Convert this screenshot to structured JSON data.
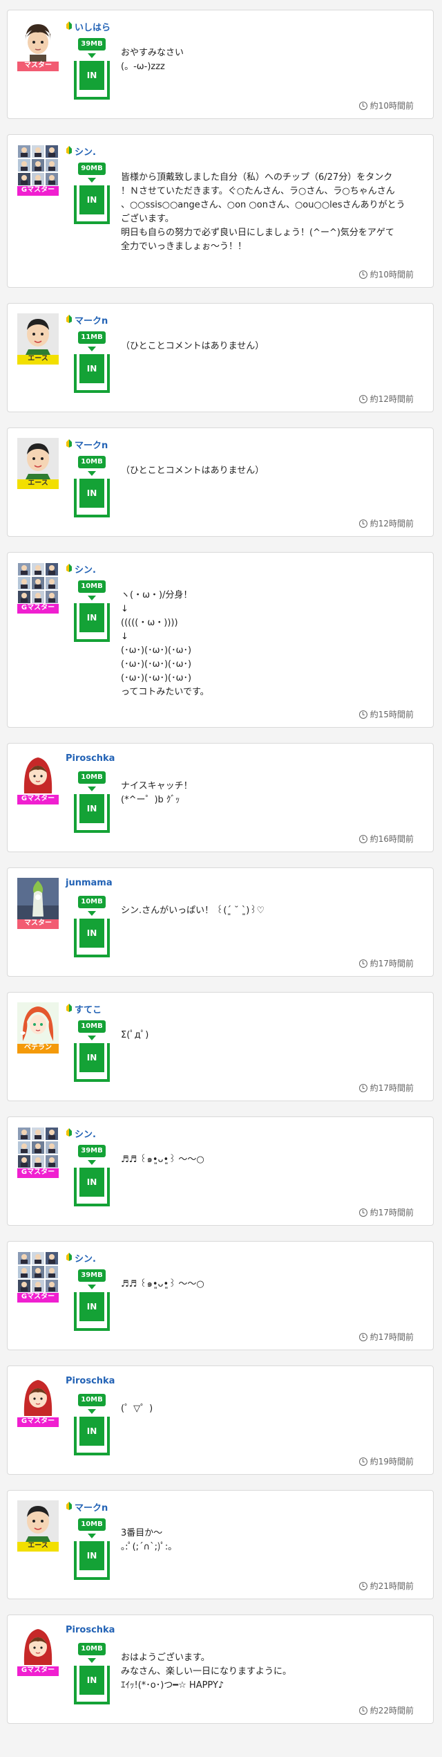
{
  "feed": [
    {
      "avatar": "boy-face",
      "name": "いしはら",
      "beginner": true,
      "rank": "マスター",
      "rank_type": "master",
      "mb": "39MB",
      "in_label": "IN",
      "comment": "おやすみなさい\n(。-ω-)zzz",
      "time": "約10時間前",
      "height": 158
    },
    {
      "avatar": "collage",
      "name": "シン.",
      "beginner": true,
      "rank": "Gマスター",
      "rank_type": "gmaster",
      "mb": "90MB",
      "in_label": "IN",
      "comment": "皆様から頂戴致しました自分（私）へのチップ（6/27分）をタンク\n！Ｎさせていただきます。ぐ○たんさん、ラ○さん、ラ○ちゃんさん\n、○○ssis○○angeさん、○on ○onさん、○ou○○lesさんありがとう\nございます。\n明日も自らの努力で必ず良い日にしましょう！(^ー^)気分をアゲて\n全力でいっきましょぉ～う！！",
      "time": "約10時間前",
      "height": 222
    },
    {
      "avatar": "man-face",
      "name": "マークn",
      "beginner": true,
      "rank": "エース",
      "rank_type": "ace",
      "mb": "11MB",
      "in_label": "IN",
      "comment": "（ひとことコメントはありません）",
      "time": "約12時間前",
      "height": 158
    },
    {
      "avatar": "man-face",
      "name": "マークn",
      "beginner": true,
      "rank": "エース",
      "rank_type": "ace",
      "mb": "10MB",
      "in_label": "IN",
      "comment": "（ひとことコメントはありません）",
      "time": "約12時間前",
      "height": 158
    },
    {
      "avatar": "collage",
      "name": "シン.",
      "beginner": true,
      "rank": "Gマスター",
      "rank_type": "gmaster",
      "mb": "10MB",
      "in_label": "IN",
      "comment": "ヽ(・ω・)/分身！\n↓\n(((((・ω・))))\n↓\n(･ω･)(･ω･)(･ω･)\n(･ω･)(･ω･)(･ω･)\n(･ω･)(･ω･)(･ω･)\nってコトみたいです。",
      "time": "約15時間前",
      "height": 254
    },
    {
      "avatar": "red-hood",
      "name": "Piroschka",
      "beginner": false,
      "rank": "Gマスター",
      "rank_type": "gmaster",
      "mb": "10MB",
      "in_label": "IN",
      "comment": "ナイスキャッチ！\n(*^ー゜)b ｸﾞｯ",
      "time": "約16時間前",
      "height": 158
    },
    {
      "avatar": "statue",
      "name": "junmama",
      "beginner": false,
      "rank": "マスター",
      "rank_type": "master",
      "mb": "10MB",
      "in_label": "IN",
      "comment": "シン.さんがいっぱい！ ꒰(ˊ͈ ˘ ˋ͈)꒱♡",
      "time": "約17時間前",
      "height": 158
    },
    {
      "avatar": "anime-girl",
      "name": "すてこ",
      "beginner": true,
      "rank": "ベテラン",
      "rank_type": "veteran",
      "mb": "10MB",
      "in_label": "IN",
      "comment": "Σ(ﾟдﾟ)",
      "time": "約17時間前",
      "height": 158
    },
    {
      "avatar": "collage",
      "name": "シン.",
      "beginner": true,
      "rank": "Gマスター",
      "rank_type": "gmaster",
      "mb": "39MB",
      "in_label": "IN",
      "comment": "♬♬ ꒰๑•͈ᴗ•͈꒱ 〜〜○",
      "time": "約17時間前",
      "height": 158
    },
    {
      "avatar": "collage",
      "name": "シン.",
      "beginner": true,
      "rank": "Gマスター",
      "rank_type": "gmaster",
      "mb": "39MB",
      "in_label": "IN",
      "comment": "♬♬ ꒰๑•͈ᴗ•͈꒱ 〜〜○",
      "time": "約17時間前",
      "height": 158
    },
    {
      "avatar": "red-hood",
      "name": "Piroschka",
      "beginner": false,
      "rank": "Gマスター",
      "rank_type": "gmaster",
      "mb": "10MB",
      "in_label": "IN",
      "comment": "(゜▽゜)",
      "time": "約19時間前",
      "height": 158
    },
    {
      "avatar": "man-face",
      "name": "マークn",
      "beginner": true,
      "rank": "エース",
      "rank_type": "ace",
      "mb": "10MB",
      "in_label": "IN",
      "comment": "3番目か〜\n｡:ﾟ(;´∩`;)ﾟ:｡",
      "time": "約21時間前",
      "height": 158
    },
    {
      "avatar": "red-hood",
      "name": "Piroschka",
      "beginner": false,
      "rank": "Gマスター",
      "rank_type": "gmaster",
      "mb": "10MB",
      "in_label": "IN",
      "comment": "おはようございます。\nみなさん、楽しい一日になりますように。\nｴｲｯ!(*･o･)つ━☆ HAPPY♪",
      "time": "約22時間前",
      "height": 158
    }
  ],
  "colors": {
    "accent_green": "#14a236",
    "name_blue": "#2262b5",
    "master": "#f25b72",
    "gmaster": "#f01fd0",
    "ace": "#f2df00",
    "veteran": "#f49a0a"
  }
}
